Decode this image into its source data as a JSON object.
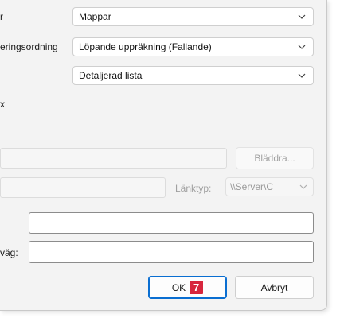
{
  "form": {
    "row1": {
      "label": "r",
      "value": "Mappar"
    },
    "row2": {
      "label": "eringsordning",
      "value": "Löpande uppräkning (Fallande)"
    },
    "row3": {
      "value": "Detaljerad lista"
    },
    "row4": {
      "label": "x"
    },
    "browse_label": "Bläddra...",
    "linktype_label": "Länktyp:",
    "linktype_value": "\\\\Server\\C",
    "path_label": "väg:"
  },
  "buttons": {
    "ok_label": "OK",
    "ok_badge": "7",
    "cancel_label": "Avbryt"
  },
  "icons": {
    "chevron": "chevron-down-icon"
  },
  "colors": {
    "accent": "#0a6ed1",
    "badge": "#d7263d"
  }
}
